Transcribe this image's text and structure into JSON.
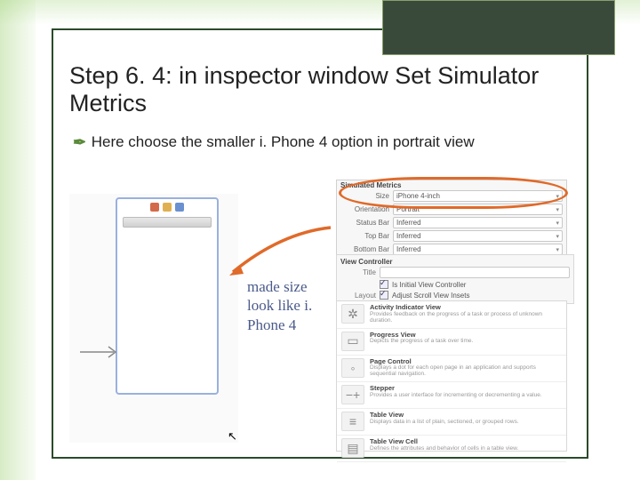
{
  "title": "Step 6. 4: in  inspector window Set Simulator Metrics",
  "bullet": "Here choose the smaller i. Phone 4 option in portrait view",
  "caption": "made size look like i. Phone 4",
  "simulated_metrics": {
    "header": "Simulated Metrics",
    "rows": [
      {
        "label": "Size",
        "value": "iPhone 4-inch"
      },
      {
        "label": "Orientation",
        "value": "Portrait"
      },
      {
        "label": "Status Bar",
        "value": "Inferred"
      },
      {
        "label": "Top Bar",
        "value": "Inferred"
      },
      {
        "label": "Bottom Bar",
        "value": "Inferred"
      }
    ]
  },
  "view_controller": {
    "header": "View Controller",
    "rows": [
      {
        "label": "Title",
        "value": ""
      },
      {
        "label": "",
        "check": true,
        "text": "Is Initial View Controller"
      },
      {
        "label": "Layout",
        "check": true,
        "text": "Adjust Scroll View Insets"
      }
    ]
  },
  "library": [
    {
      "icon": "✲",
      "name": "Activity Indicator View",
      "desc": "Provides feedback on the progress of a task or process of unknown duration."
    },
    {
      "icon": "▭",
      "name": "Progress View",
      "desc": "Depicts the progress of a task over time."
    },
    {
      "icon": "◦",
      "name": "Page Control",
      "desc": "Displays a dot for each open page in an application and supports sequential navigation."
    },
    {
      "icon": "−+",
      "name": "Stepper",
      "desc": "Provides a user interface for incrementing or decrementing a value."
    },
    {
      "icon": "≡",
      "name": "Table View",
      "desc": "Displays data in a list of plain, sectioned, or grouped rows."
    },
    {
      "icon": "▤",
      "name": "Table View Cell",
      "desc": "Defines the attributes and behavior of cells in a table view."
    }
  ]
}
